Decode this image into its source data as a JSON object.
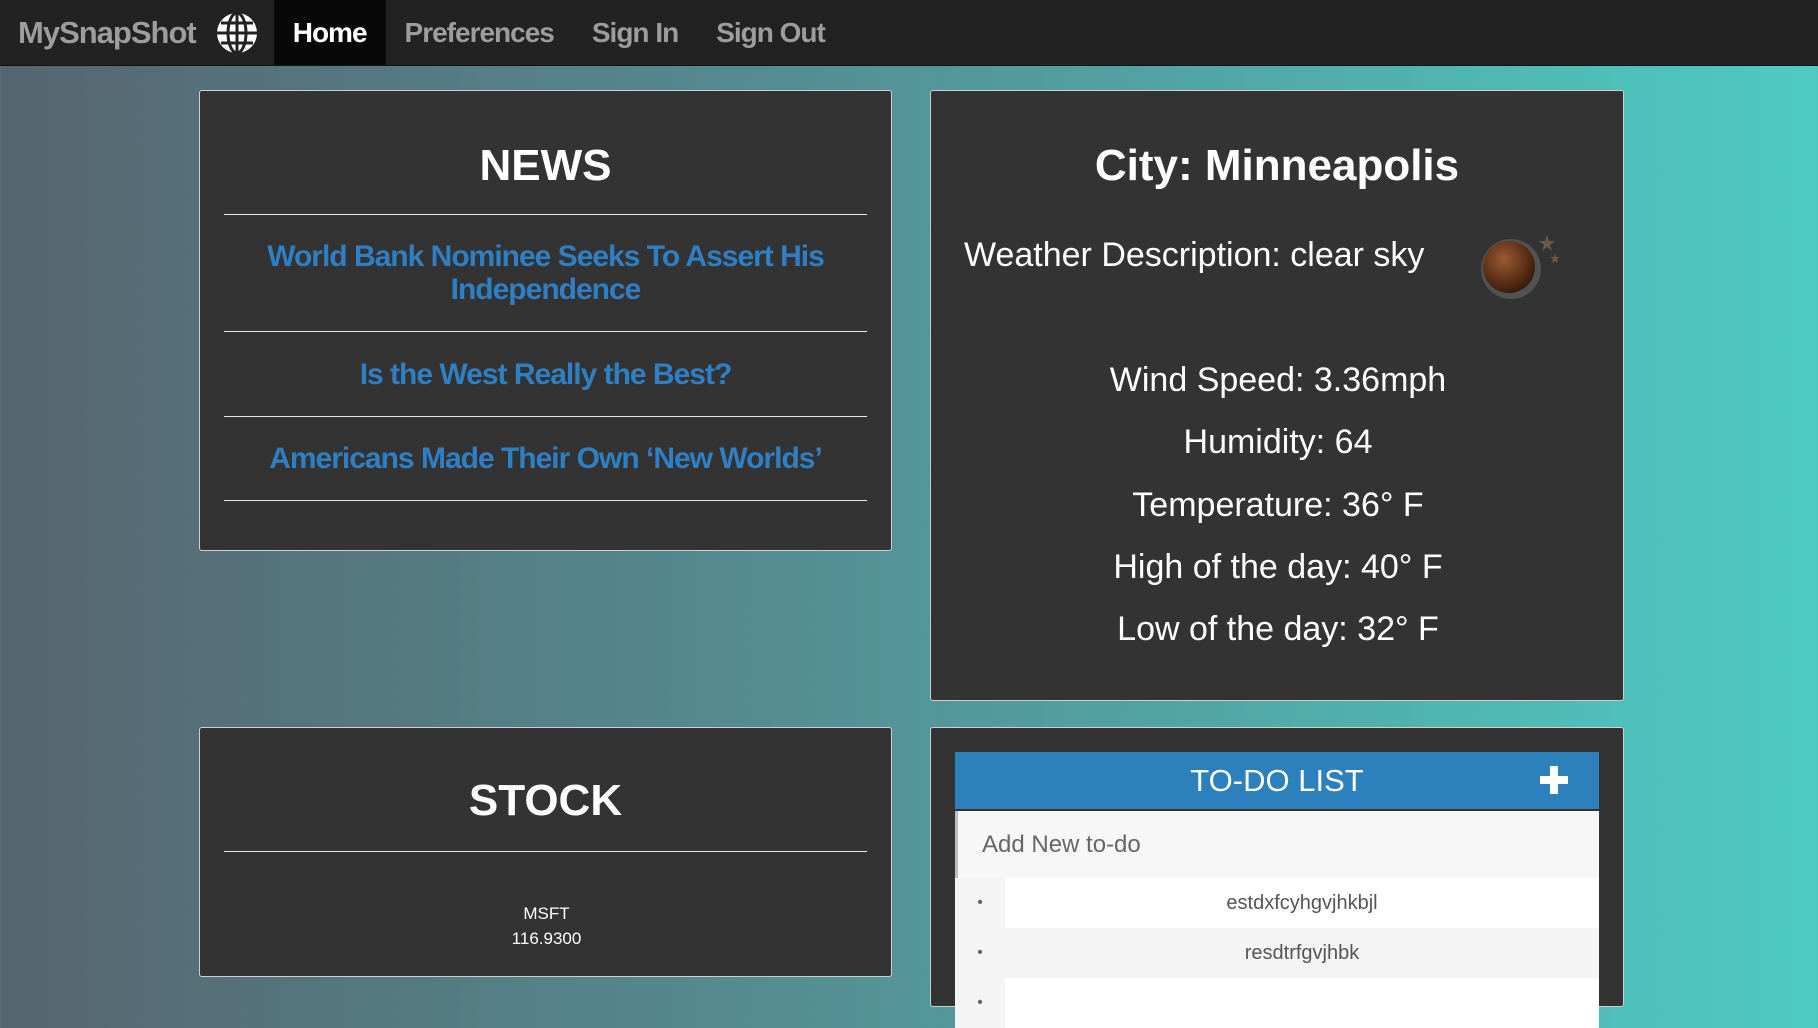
{
  "nav": {
    "brand": "MySnapShot",
    "brand_icon": "globe-icon",
    "items": [
      {
        "label": "Home",
        "active": true
      },
      {
        "label": "Preferences",
        "active": false
      },
      {
        "label": "Sign In",
        "active": false
      },
      {
        "label": "Sign Out",
        "active": false
      }
    ]
  },
  "news": {
    "title": "NEWS",
    "items": [
      {
        "headline": "World Bank Nominee Seeks To Assert His Independence"
      },
      {
        "headline": "Is the West Really the Best?"
      },
      {
        "headline": "Americans Made Their Own ‘New Worlds’"
      }
    ],
    "link_color": "#2f7fc4"
  },
  "weather": {
    "city_label": "City: Minneapolis",
    "description": "Weather Description: clear sky",
    "icon": "clear-night-moon-icon",
    "wind": "Wind Speed: 3.36mph",
    "humidity": "Humidity: 64",
    "temperature": "Temperature: 36° F",
    "high": "High of the day: 40° F",
    "low": "Low of the day: 32° F"
  },
  "stock": {
    "title": "STOCK",
    "symbol": "MSFT",
    "price": "116.9300"
  },
  "todo": {
    "title": "TO-DO LIST",
    "add_icon": "plus-icon",
    "input_placeholder": "Add New to-do",
    "items": [
      {
        "text": "estdxfcyhgvjhkbjl"
      },
      {
        "text": "resdtrfgvjhbk"
      },
      {
        "text": ""
      }
    ],
    "header_color": "#2c80bc"
  }
}
